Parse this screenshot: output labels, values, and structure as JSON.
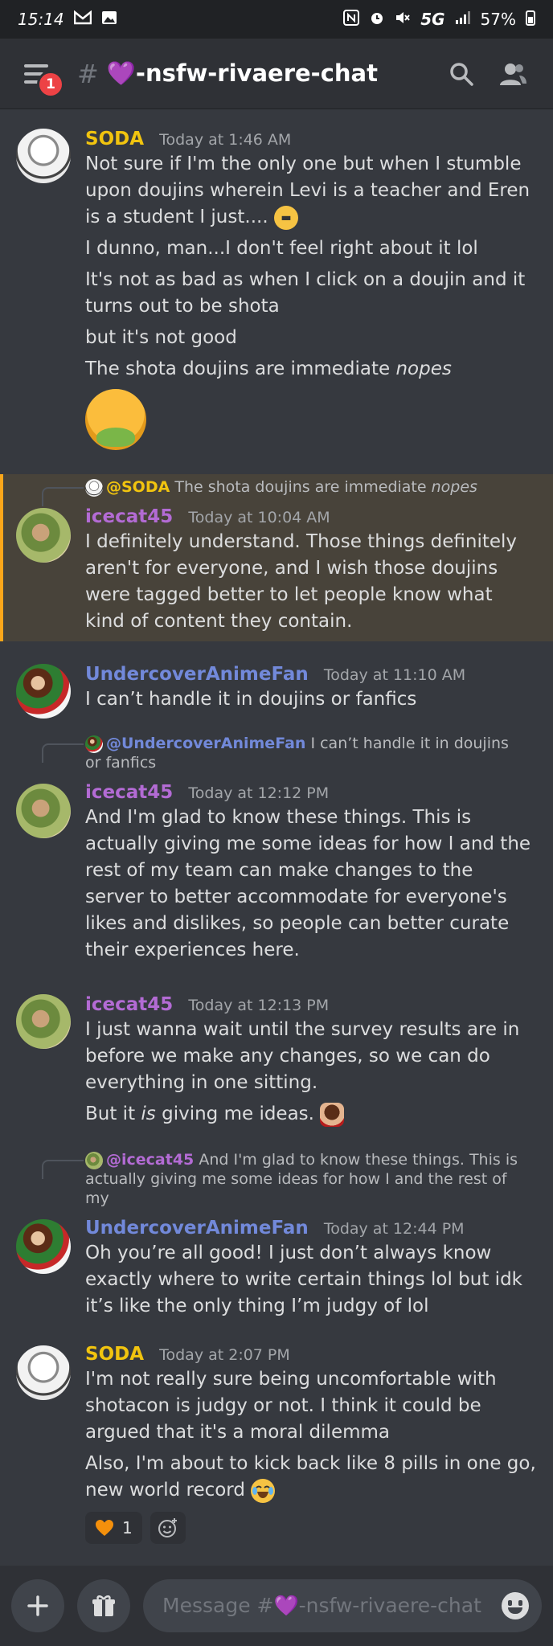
{
  "status": {
    "time": "15:14",
    "left_icons": [
      "gmail-icon",
      "gallery-icon"
    ],
    "network": "5G",
    "battery": "57%"
  },
  "header": {
    "badge": "1",
    "hash": "#",
    "channel": "💜-nsfw-rivaere-chat"
  },
  "colors": {
    "soda": "#f1c40f",
    "icecat": "#b36bd4",
    "uaf": "#7289da",
    "mention": "#7289da",
    "highlight_bar": "#faa61a"
  },
  "messages": [
    {
      "author": "SODA",
      "time": "Today at 1:46 AM",
      "lines": [
        "Not sure if I'm the only one but when I stumble upon doujins wherein Levi is a teacher and Eren is a student I just....",
        "I dunno, man...I don't feel right about it lol",
        "It's not as bad as when I click on a doujin and it turns out to be shota",
        "but it's not good",
        "The shota doujins are immediate ",
        "nopes"
      ]
    },
    {
      "reply": {
        "mention": "@SODA",
        "text": "The shota doujins are immediate ",
        "italic": "nopes"
      },
      "author": "icecat45",
      "time": "Today at 10:04 AM",
      "lines": [
        "I definitely understand. Those things definitely aren't for everyone, and I wish those doujins were tagged better to let people know what kind of content they contain."
      ]
    },
    {
      "author": "UndercoverAnimeFan",
      "time": "Today at 11:10 AM",
      "lines": [
        "I can’t handle it in doujins or fanfics"
      ]
    },
    {
      "reply": {
        "mention": "@UndercoverAnimeFan",
        "text": "I can’t handle it in doujins or fanfics"
      },
      "author": "icecat45",
      "time": "Today at 12:12 PM",
      "lines": [
        "And I'm glad to know these things.  This is actually giving me some ideas for how I and the rest of my team can make changes to the server to better accommodate for everyone's likes and dislikes, so people can better curate their experiences here."
      ]
    },
    {
      "author": "icecat45",
      "time": "Today at 12:13 PM",
      "lines": [
        "I just wanna wait until the survey results are in before we make any changes, so we can do everything in one sitting.",
        "But it ",
        "is",
        " giving me ideas."
      ]
    },
    {
      "reply": {
        "mention": "@icecat45",
        "text": "And I'm glad to know these things.  This is actually giving me some ideas for how I and the rest of my"
      },
      "author": "UndercoverAnimeFan",
      "time": "Today at 12:44 PM",
      "lines": [
        "Oh you’re all good! I just don’t always know exactly where to write certain things lol but idk it’s like the only thing I’m judgy of lol"
      ]
    },
    {
      "author": "SODA",
      "time": "Today at 2:07 PM",
      "lines": [
        "I'm not really sure being uncomfortable with shotacon is judgy or not. I think it could be argued that it's a moral dilemma",
        "Also, I'm about to kick back like 8 pills in one go, new world record"
      ],
      "reaction_count": "1"
    }
  ],
  "composer": {
    "placeholder": "Message #💜-nsfw-rivaere-chat"
  }
}
